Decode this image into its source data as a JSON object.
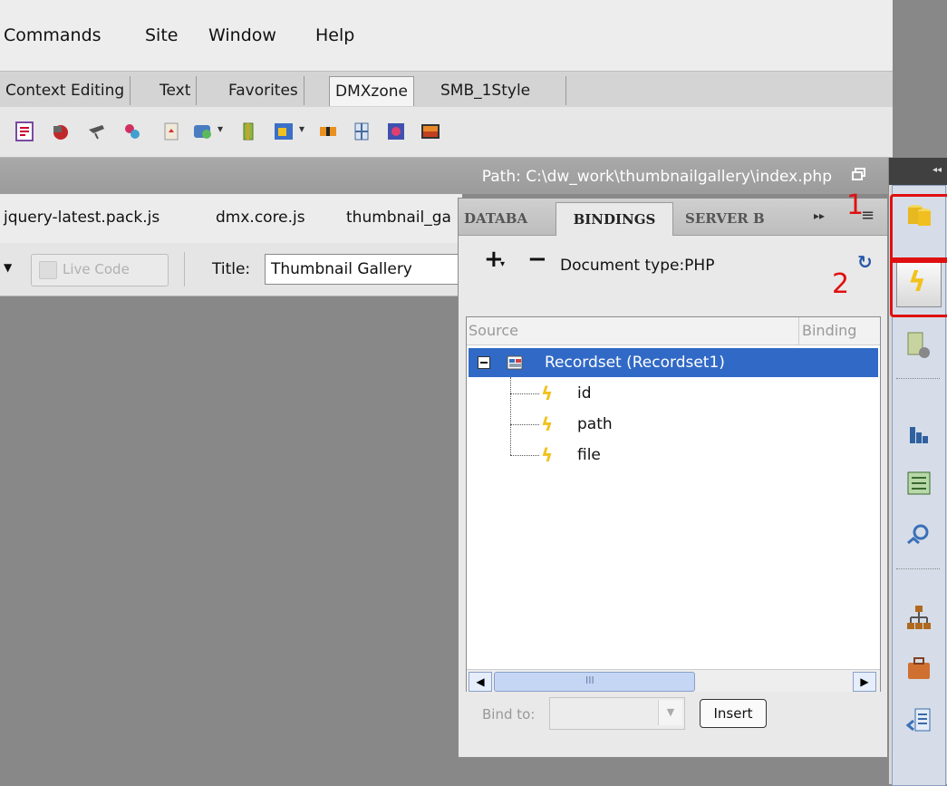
{
  "menu": [
    "Commands",
    "Site",
    "Window",
    "Help"
  ],
  "insert_tabs": [
    "Context Editing",
    "Text",
    "Favorites",
    "DMXzone",
    "SMB_1Style"
  ],
  "toolbar_icons": [
    "spry-icon",
    "flash-icon",
    "hand-icon",
    "tool-icon",
    "page-icon",
    "image-add-icon",
    "book-icon",
    "gallery-icon",
    "film-icon",
    "network-icon",
    "photo-icon",
    "sunset-icon"
  ],
  "path": "Path:  C:\\dw_work\\thumbnailgallery\\index.php",
  "related_files": [
    "jquery-latest.pack.js",
    "dmx.core.js",
    "thumbnail_ga"
  ],
  "doc_toolbar": {
    "live_code_label": "Live Code",
    "title_label": "Title:",
    "title_value": "Thumbnail Gallery"
  },
  "panel": {
    "tabs": [
      "DATABA",
      "BINDINGS",
      "SERVER B"
    ],
    "plus": "+",
    "minus": "−",
    "doc_type": "Document type:PHP",
    "columns": [
      "Source",
      "Binding"
    ],
    "recordset_label": "Recordset (Recordset1)",
    "fields": [
      "id",
      "path",
      "file"
    ],
    "scroll_label": "III",
    "bind_to_label": "Bind to:",
    "insert_label": "Insert"
  },
  "annotations": [
    "1",
    "2"
  ],
  "colors": {
    "selection": "#3169c6",
    "annotation": "#e01010",
    "bolt": "#f2c21b"
  }
}
